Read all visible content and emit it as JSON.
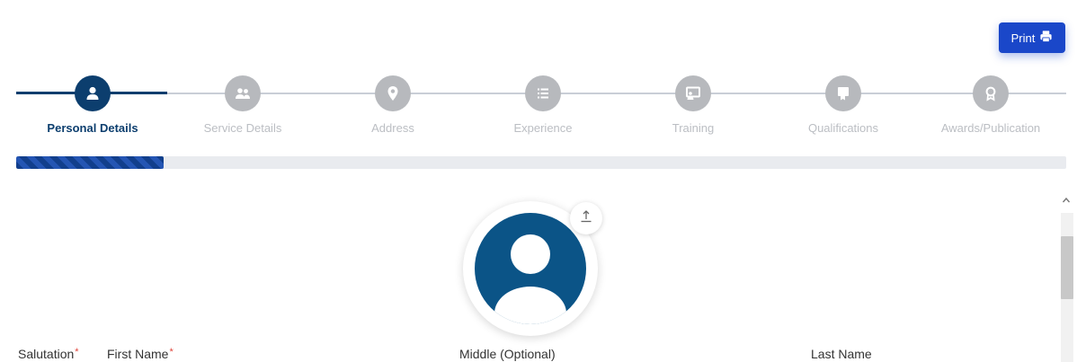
{
  "toolbar": {
    "print_label": "Print"
  },
  "stepper": {
    "steps": [
      {
        "label": "Personal Details",
        "icon": "user-icon",
        "active": true
      },
      {
        "label": "Service Details",
        "icon": "users-icon",
        "active": false
      },
      {
        "label": "Address",
        "icon": "map-pin-icon",
        "active": false
      },
      {
        "label": "Experience",
        "icon": "list-icon",
        "active": false
      },
      {
        "label": "Training",
        "icon": "chalkboard-icon",
        "active": false
      },
      {
        "label": "Qualifications",
        "icon": "certificate-icon",
        "active": false
      },
      {
        "label": "Awards/Publication",
        "icon": "award-icon",
        "active": false
      }
    ],
    "progress_fraction": 0.14
  },
  "profile": {
    "upload_icon": "upload-icon"
  },
  "form": {
    "labels": {
      "salutation": "Salutation",
      "first_name": "First Name",
      "middle_name": "Middle (Optional)",
      "last_name": "Last Name"
    },
    "required_mark": "*"
  },
  "colors": {
    "primary": "#0c3e6e",
    "print_button": "#1a47c9",
    "inactive_step": "#b7b9bd",
    "avatar_bg": "#0b5487",
    "required": "#e0433a"
  }
}
